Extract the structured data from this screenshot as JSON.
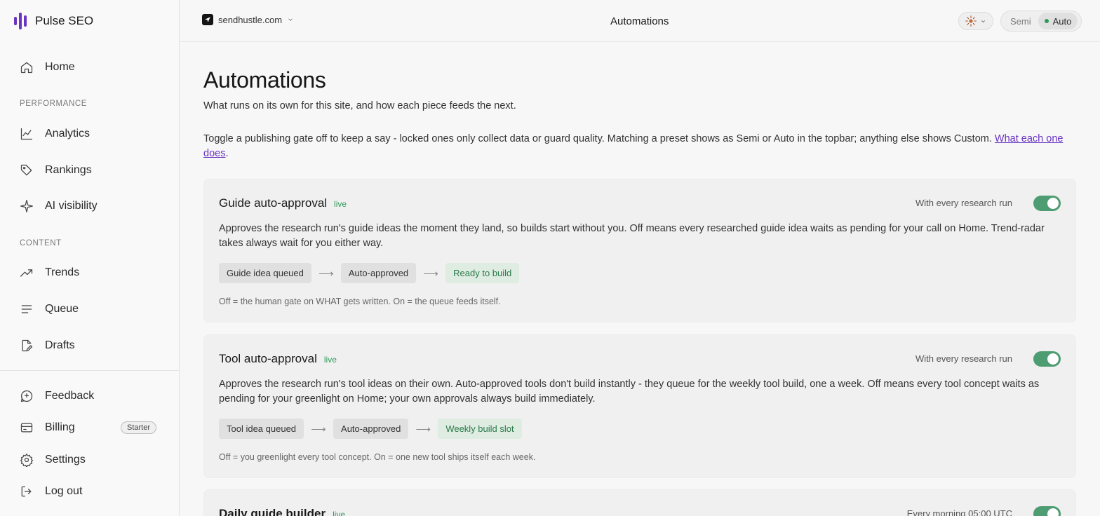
{
  "app": {
    "name": "Pulse SEO",
    "brand_color": "#6a35c2"
  },
  "sidebar": {
    "items_top": [
      {
        "label": "Home",
        "icon": "home-icon"
      }
    ],
    "sections": [
      {
        "label": "PERFORMANCE",
        "items": [
          {
            "label": "Analytics",
            "icon": "chart-line-icon"
          },
          {
            "label": "Rankings",
            "icon": "tag-icon"
          },
          {
            "label": "AI visibility",
            "icon": "sparkle-icon"
          }
        ]
      },
      {
        "label": "CONTENT",
        "items": [
          {
            "label": "Trends",
            "icon": "trend-up-icon"
          },
          {
            "label": "Queue",
            "icon": "list-icon"
          },
          {
            "label": "Drafts",
            "icon": "draft-icon"
          }
        ]
      }
    ],
    "bottom": [
      {
        "label": "Feedback",
        "icon": "feedback-icon"
      },
      {
        "label": "Billing",
        "icon": "card-icon",
        "badge": "Starter"
      },
      {
        "label": "Settings",
        "icon": "gear-icon"
      },
      {
        "label": "Log out",
        "icon": "logout-icon"
      }
    ]
  },
  "topbar": {
    "site": "sendhustle.com",
    "title": "Automations",
    "mode_options": [
      "Semi",
      "Auto"
    ],
    "mode_selected": "Auto"
  },
  "page": {
    "title": "Automations",
    "subtitle": "What runs on its own for this site, and how each piece feeds the next.",
    "note": "Toggle a publishing gate off to keep a say - locked ones only collect data or guard quality. Matching a preset shows as Semi or Auto in the topbar; anything else shows Custom. ",
    "note_link": "What each one does",
    "note_end": "."
  },
  "cards": [
    {
      "title": "Guide auto-approval",
      "status": "live",
      "schedule": "With every research run",
      "enabled": true,
      "description": "Approves the research run's guide ideas the moment they land, so builds start without you. Off means every researched guide idea waits as pending for your call on Home. Trend-radar takes always wait for you either way.",
      "flow": [
        "Guide idea queued",
        "Auto-approved",
        "Ready to build"
      ],
      "arrow": "⟶",
      "footnote": "Off = the human gate on WHAT gets written. On = the queue feeds itself."
    },
    {
      "title": "Tool auto-approval",
      "status": "live",
      "schedule": "With every research run",
      "enabled": true,
      "description": "Approves the research run's tool ideas on their own. Auto-approved tools don't build instantly - they queue for the weekly tool build, one a week. Off means every tool concept waits as pending for your greenlight on Home; your own approvals always build immediately.",
      "flow": [
        "Tool idea queued",
        "Auto-approved",
        "Weekly build slot"
      ],
      "arrow": "⟶",
      "footnote": "Off = you greenlight every tool concept. On = one new tool ships itself each week."
    },
    {
      "title": "Daily guide builder",
      "status": "live",
      "schedule": "Every morning 05:00 UTC",
      "enabled": true
    }
  ]
}
